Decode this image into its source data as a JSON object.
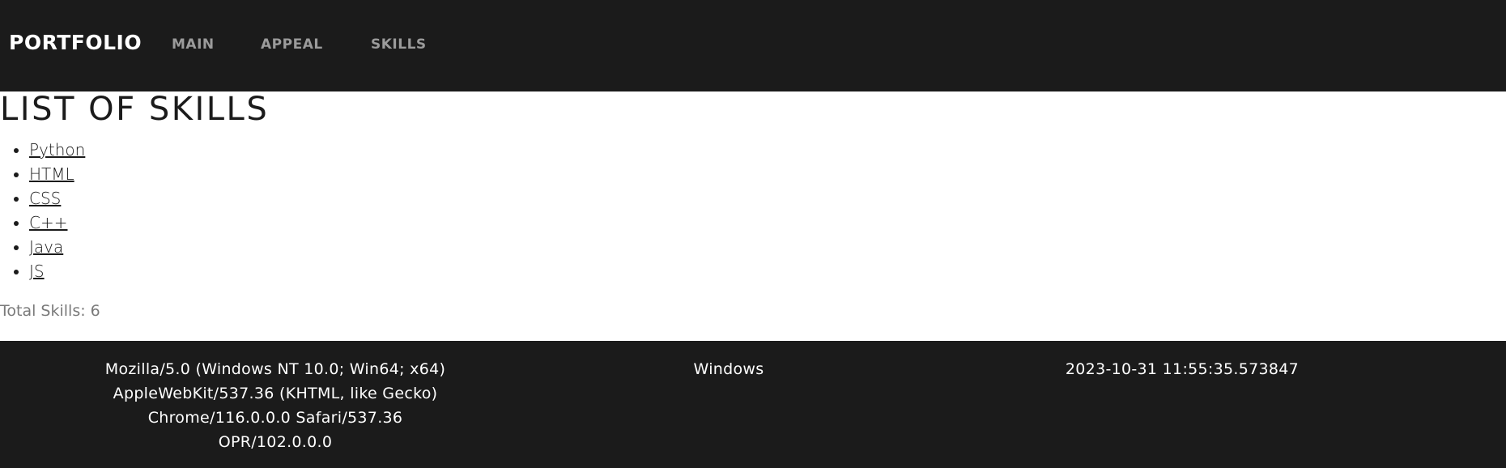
{
  "navbar": {
    "brand": "PORTFOLIO",
    "links": [
      {
        "label": "MAIN"
      },
      {
        "label": "APPEAL"
      },
      {
        "label": "SKILLS"
      }
    ]
  },
  "main": {
    "title": "LIST OF SKILLS",
    "skills": [
      "Python",
      "HTML",
      "CSS",
      "C++",
      "Java",
      "JS"
    ],
    "total_label": "Total Skills: 6"
  },
  "footer": {
    "user_agent_lines": [
      "Mozilla/5.0 (Windows NT 10.0; Win64; x64)",
      "AppleWebKit/537.36 (KHTML, like Gecko)",
      "Chrome/116.0.0.0 Safari/537.36",
      "OPR/102.0.0.0"
    ],
    "os": "Windows",
    "timestamp": "2023-10-31 11:55:35.573847"
  },
  "colors": {
    "dark_bg": "#1b1b1b",
    "nav_link": "#9b9b9b",
    "muted_text": "#7a7a7a"
  }
}
